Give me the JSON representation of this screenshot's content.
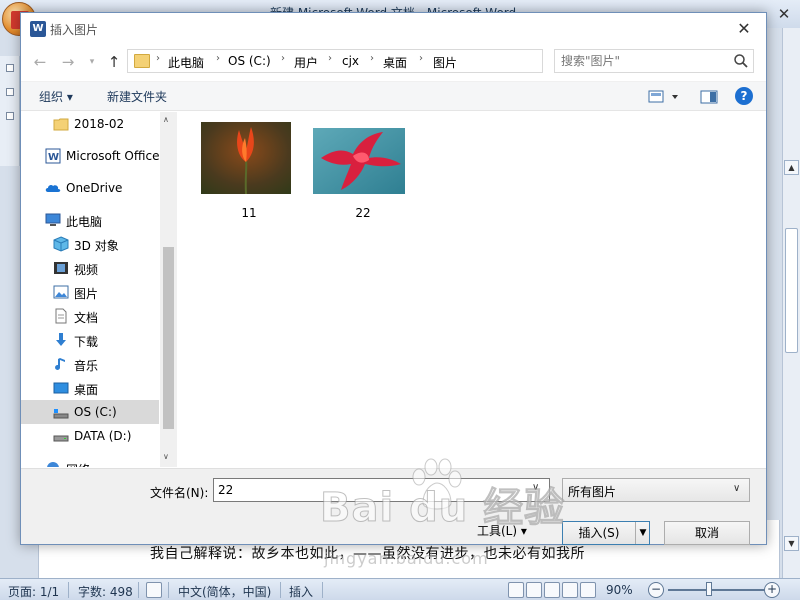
{
  "word": {
    "title": "新建 Microsoft Word 文档 - Microsoft Word",
    "doc_text": "我自己解释说：故乡本也如此，——虽然没有进步，也未必有如我所",
    "status": {
      "page": "页面: 1/1",
      "words": "字数: 498",
      "language": "中文(简体，中国)",
      "mode": "插入",
      "zoom": "90%",
      "zoom_minus": "−",
      "zoom_plus": "+"
    }
  },
  "dialog": {
    "title": "插入图片",
    "title_icon": "W",
    "close": "✕",
    "breadcrumbs": [
      "此电脑",
      "OS (C:)",
      "用户",
      "cjx",
      "桌面",
      "图片"
    ],
    "search_placeholder": "搜索\"图片\"",
    "toolbar": {
      "organize": "组织 ▾",
      "new_folder": "新建文件夹",
      "help": "?"
    },
    "nav_items": [
      {
        "label": "2018-02",
        "icon": "folder-icon"
      },
      {
        "label": "Microsoft Office",
        "icon": "word-icon"
      },
      {
        "label": "OneDrive",
        "icon": "cloud-icon"
      },
      {
        "label": "此电脑",
        "icon": "computer-icon"
      },
      {
        "label": "3D 对象",
        "icon": "cube-icon"
      },
      {
        "label": "视频",
        "icon": "video-icon"
      },
      {
        "label": "图片",
        "icon": "picture-icon"
      },
      {
        "label": "文档",
        "icon": "document-icon"
      },
      {
        "label": "下载",
        "icon": "download-icon"
      },
      {
        "label": "音乐",
        "icon": "music-icon"
      },
      {
        "label": "桌面",
        "icon": "desktop-icon"
      },
      {
        "label": "OS (C:)",
        "icon": "drive-icon"
      },
      {
        "label": "DATA (D:)",
        "icon": "drive-icon"
      },
      {
        "label": "网络",
        "icon": "network-icon"
      }
    ],
    "files": [
      {
        "name": "11"
      },
      {
        "name": "22"
      }
    ],
    "filename_label": "文件名(N):",
    "filename_value": "22",
    "filetype": "所有图片",
    "tools": "工具(L) ▾",
    "insert": "插入(S)",
    "cancel": "取消"
  },
  "watermark": {
    "text": "Bai  du 经验",
    "sub": "jingyan.baidu.com"
  }
}
